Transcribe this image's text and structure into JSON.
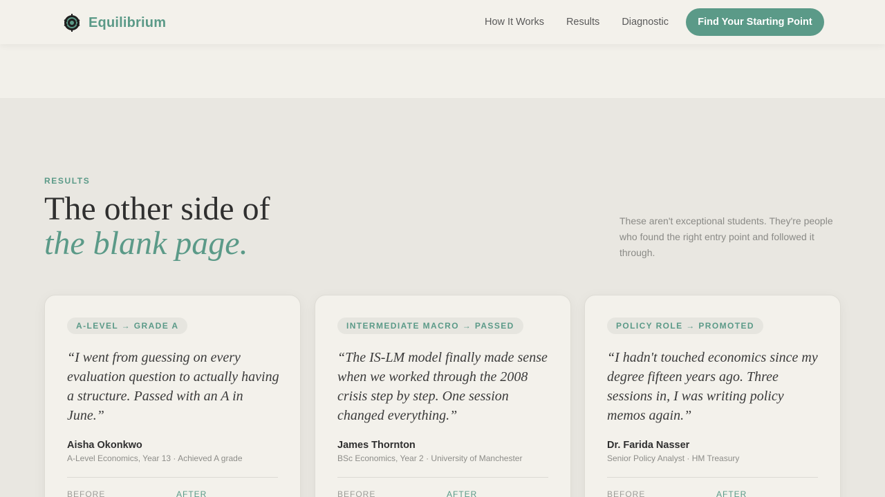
{
  "nav": {
    "brand": "Equilibrium",
    "links": [
      "How It Works",
      "Results",
      "Diagnostic"
    ],
    "cta": "Find Your Starting Point"
  },
  "section": {
    "eyebrow": "RESULTS",
    "headline_line1": "The other side of",
    "headline_line2": "the blank page.",
    "intro": "These aren't exceptional students. They're people who found the right entry point and followed it through."
  },
  "testimonials": [
    {
      "tag": "A-LEVEL → GRADE A",
      "quote": "“I went from guessing on every evaluation question to actually having a structure. Passed with an A in June.”",
      "name": "Aisha Okonkwo",
      "meta": "A-Level Economics, Year 13 · Achieved A grade",
      "before_label": "BEFORE",
      "after_label": "AFTER"
    },
    {
      "tag": "INTERMEDIATE MACRO → PASSED",
      "quote": "“The IS-LM model finally made sense when we worked through the 2008 crisis step by step. One session changed everything.”",
      "name": "James Thornton",
      "meta": "BSc Economics, Year 2 · University of Manchester",
      "before_label": "BEFORE",
      "after_label": "AFTER"
    },
    {
      "tag": "POLICY ROLE → PROMOTED",
      "quote": "“I hadn't touched economics since my degree fifteen years ago. Three sessions in, I was writing policy memos again.”",
      "name": "Dr. Farida Nasser",
      "meta": "Senior Policy Analyst · HM Treasury",
      "before_label": "BEFORE",
      "after_label": "AFTER"
    }
  ],
  "colors": {
    "accent": "#5b9a88",
    "background": "#e9e7e1",
    "card": "#f3f1eb"
  },
  "icons": {
    "logo": "equilibrium-logo-icon"
  }
}
